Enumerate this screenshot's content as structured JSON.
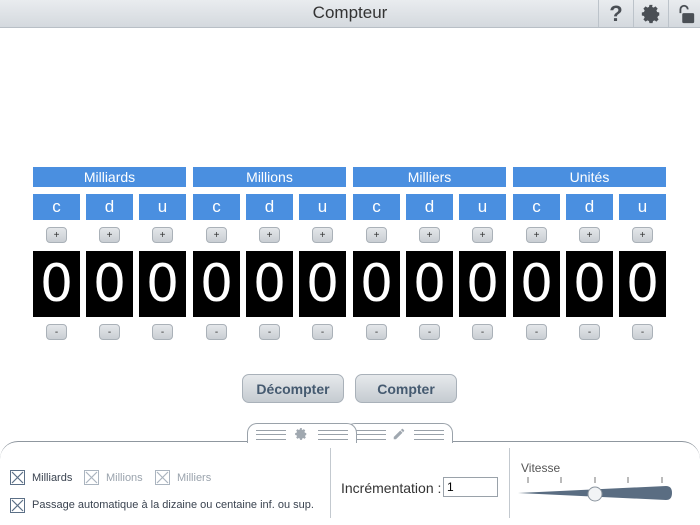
{
  "window": {
    "title": "Compteur"
  },
  "toolbar": {
    "help_icon": "question-mark-icon",
    "settings_icon": "gear-icon",
    "lock_icon": "lock-icon"
  },
  "groups": [
    {
      "label": "Milliards"
    },
    {
      "label": "Millions"
    },
    {
      "label": "Milliers"
    },
    {
      "label": "Unités"
    }
  ],
  "place_letters": [
    "c",
    "d",
    "u"
  ],
  "buttons": {
    "plus": "+",
    "minus": "-"
  },
  "digits": [
    "0",
    "0",
    "0",
    "0",
    "0",
    "0",
    "0",
    "0",
    "0",
    "0",
    "0",
    "0"
  ],
  "actions": {
    "decount": "Décompter",
    "count": "Compter"
  },
  "settings": {
    "show_milliards": {
      "label": "Milliards",
      "checked": true
    },
    "show_millions": {
      "label": "Millions",
      "checked": true
    },
    "show_milliers": {
      "label": "Milliers",
      "checked": true
    },
    "auto_carry": {
      "label": "Passage automatique à la dizaine ou centaine inf. ou sup.",
      "checked": true
    },
    "increment": {
      "label": "Incrémentation :",
      "value": "1"
    },
    "speed": {
      "label": "Vitesse",
      "level_fraction": 0.5
    }
  },
  "colors": {
    "accent": "#4a8fe0",
    "digit_bg": "#000000"
  }
}
